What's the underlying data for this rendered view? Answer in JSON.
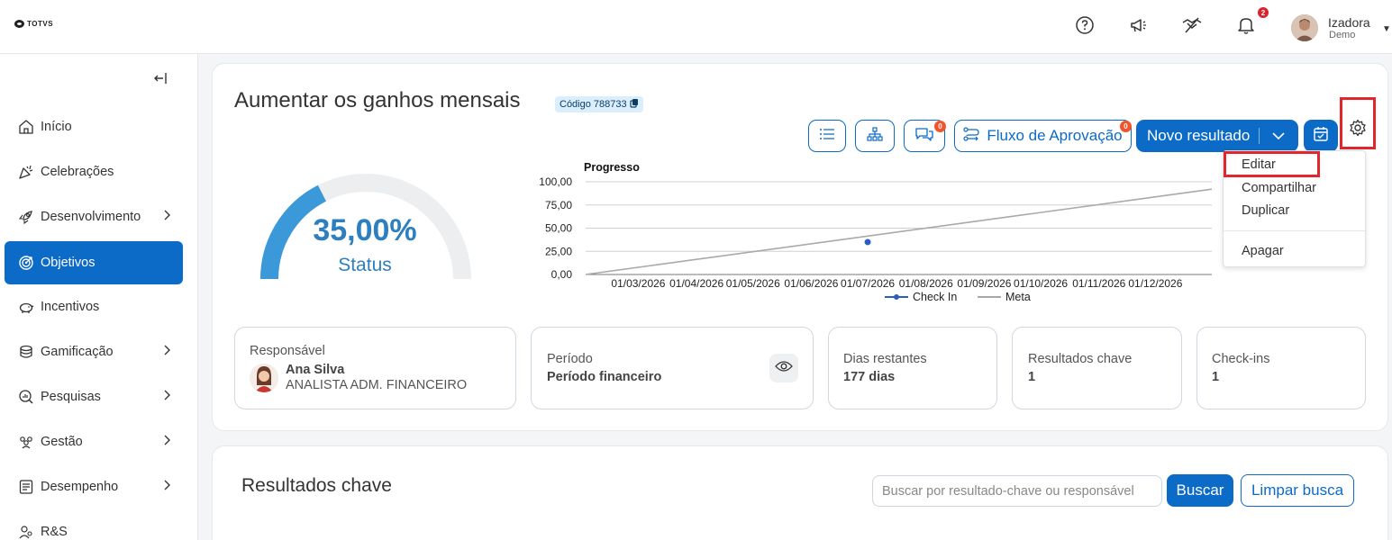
{
  "header": {
    "logo_text": "TOTVS",
    "notification_count": "2",
    "user_name": "Izadora",
    "user_role": "Demo",
    "icons": [
      "help-icon",
      "megaphone-icon",
      "handshake-icon",
      "bell-icon"
    ]
  },
  "sidebar": {
    "items": [
      {
        "label": "Início",
        "icon": "home-icon",
        "has_submenu": false,
        "active": false
      },
      {
        "label": "Celebrações",
        "icon": "party-icon",
        "has_submenu": false,
        "active": false
      },
      {
        "label": "Desenvolvimento",
        "icon": "rocket-icon",
        "has_submenu": true,
        "active": false
      },
      {
        "label": "Objetivos",
        "icon": "target-icon",
        "has_submenu": false,
        "active": true
      },
      {
        "label": "Incentivos",
        "icon": "piggy-bank-icon",
        "has_submenu": false,
        "active": false
      },
      {
        "label": "Gamificação",
        "icon": "coins-icon",
        "has_submenu": true,
        "active": false
      },
      {
        "label": "Pesquisas",
        "icon": "search-chart-icon",
        "has_submenu": true,
        "active": false
      },
      {
        "label": "Gestão",
        "icon": "team-icon",
        "has_submenu": true,
        "active": false
      },
      {
        "label": "Desempenho",
        "icon": "checklist-icon",
        "has_submenu": true,
        "active": false
      },
      {
        "label": "R&S",
        "icon": "recruit-icon",
        "has_submenu": false,
        "active": false
      }
    ]
  },
  "objective": {
    "title": "Aumentar os ganhos mensais",
    "code_label": "Código 788733",
    "toolbar": {
      "comments_count": "0",
      "approval_flow_label": "Fluxo de Aprovação",
      "approval_count": "0",
      "new_result_label": "Novo resultado"
    },
    "menu": {
      "items": [
        "Editar",
        "Compartilhar",
        "Duplicar",
        "Apagar"
      ]
    },
    "gauge": {
      "value_text": "35,00%",
      "label": "Status",
      "fraction": 0.35
    }
  },
  "chart_data": {
    "type": "line",
    "title": "Progresso",
    "x": [
      "01/03/2026",
      "01/04/2026",
      "01/05/2026",
      "01/06/2026",
      "01/07/2026",
      "01/08/2026",
      "01/09/2026",
      "01/10/2026",
      "01/11/2026",
      "01/12/2026"
    ],
    "y_ticks": [
      "100,00",
      "75,00",
      "50,00",
      "25,00",
      "0,00"
    ],
    "ylim": [
      0,
      100
    ],
    "series": [
      {
        "name": "Check In",
        "color": "#2b5fbd",
        "points": [
          {
            "x": "2026-07-01",
            "y": 35
          }
        ]
      },
      {
        "name": "Meta",
        "color": "#a9a9a9",
        "points": [
          {
            "x": "2026-02-01",
            "y": 0
          },
          {
            "x": "2026-12-31",
            "y": 92
          }
        ]
      }
    ],
    "legend": "bottom",
    "grid": true
  },
  "info": {
    "responsible_label": "Responsável",
    "responsible_name": "Ana Silva",
    "responsible_role": "ANALISTA ADM. FINANCEIRO",
    "period_label": "Período",
    "period_value": "Período financeiro",
    "days_label": "Dias restantes",
    "days_value": "177 dias",
    "key_results_label": "Resultados chave",
    "key_results_value": "1",
    "checkins_label": "Check-ins",
    "checkins_value": "1"
  },
  "key_results": {
    "title": "Resultados chave",
    "search_placeholder": "Buscar por resultado-chave ou responsável",
    "search_button": "Buscar",
    "clear_button": "Limpar busca"
  },
  "colors": {
    "primary": "#0c6bc7",
    "gauge_fill": "#3b99d9",
    "gauge_track": "#eceef0",
    "highlight": "#e2262b",
    "badge": "#f2552c"
  }
}
